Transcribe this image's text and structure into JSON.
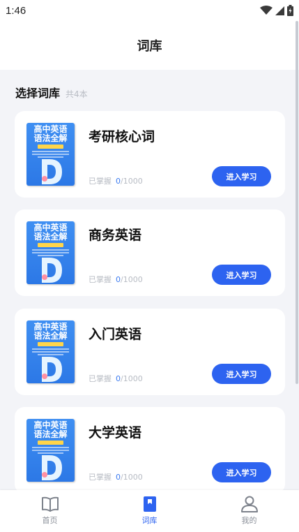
{
  "status_bar": {
    "time": "1:46"
  },
  "header": {
    "title": "词库"
  },
  "section": {
    "title": "选择词库",
    "count": "共4本"
  },
  "cover": {
    "line1": "高中英语",
    "line2": "语法全解"
  },
  "books": [
    {
      "title": "考研核心词",
      "progress_label": "已掌握",
      "learned": "0",
      "total": "/1000",
      "action": "进入学习"
    },
    {
      "title": "商务英语",
      "progress_label": "已掌握",
      "learned": "0",
      "total": "/1000",
      "action": "进入学习"
    },
    {
      "title": "入门英语",
      "progress_label": "已掌握",
      "learned": "0",
      "total": "/1000",
      "action": "进入学习"
    },
    {
      "title": "大学英语",
      "progress_label": "已掌握",
      "learned": "0",
      "total": "/1000",
      "action": "进入学习"
    }
  ],
  "tabbar": {
    "items": [
      {
        "label": "首页",
        "icon": "book-open-icon"
      },
      {
        "label": "词库",
        "icon": "bookmark-icon",
        "active": true
      },
      {
        "label": "我的",
        "icon": "user-icon"
      }
    ]
  },
  "colors": {
    "accent": "#2d63f0",
    "background": "#f3f4f8",
    "card": "#ffffff"
  }
}
